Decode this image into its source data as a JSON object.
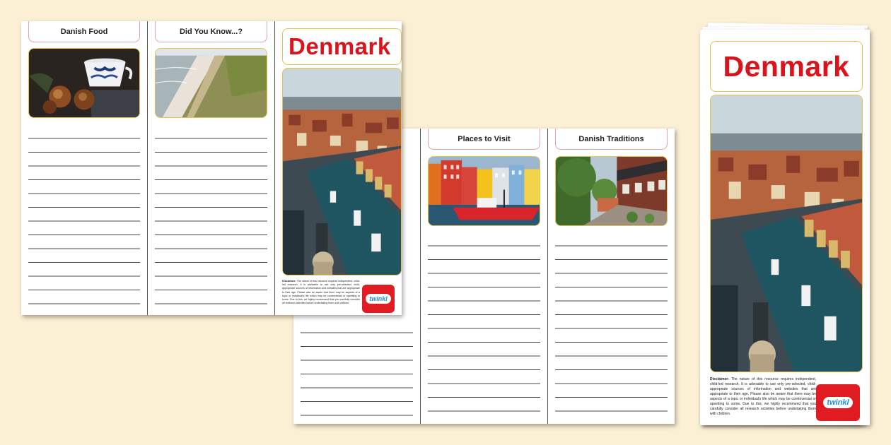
{
  "leaflet_left": {
    "panels": [
      {
        "header": "Danish Food",
        "image_icon": "coffee-and-pastries-photo"
      },
      {
        "header": "Did You Know...?",
        "image_icon": "coastal-dunes-photo"
      }
    ],
    "cover": {
      "title": "Denmark",
      "image_icon": "copenhagen-canal-photo",
      "disclaimer_label": "Disclaimer:",
      "disclaimer_text": "The nature of this resource requires independent, child-led research. It is advisable to use only pre-selected, child-appropriate sources of information and websites that are appropriate to their age. Please also be aware that there may be aspects of a topic or individual's life which may be controversial or upsetting to some. Due to this, we highly recommend that you carefully consider all research activities before undertaking them with children.",
      "logo_text": "twinkl"
    }
  },
  "leaflet_middle": {
    "panels": [
      {
        "header": "Places to Visit",
        "image_icon": "colourful-harbour-houses-photo"
      },
      {
        "header": "Danish Traditions",
        "image_icon": "cobbled-street-cottages-photo"
      }
    ]
  },
  "leaflet_right": {
    "title": "Denmark",
    "image_icon": "copenhagen-canal-photo",
    "disclaimer_label": "Disclaimer:",
    "disclaimer_text": "The nature of this resource requires independent, child-led research. It is advisable to use only pre-selected, child-appropriate sources of information and websites that are appropriate to their age. Please also be aware that there may be aspects of a topic or individual's life which may be controversial or upsetting to some. Due to this, we highly recommend that you carefully consider all research activities before undertaking them with children.",
    "logo_text": "twinkl"
  },
  "colors": {
    "background": "#fcf0d4",
    "title_red": "#d9141c",
    "logo_red": "#e01b22",
    "photo_border": "#e6c250",
    "header_border": "#e7a1a8"
  }
}
